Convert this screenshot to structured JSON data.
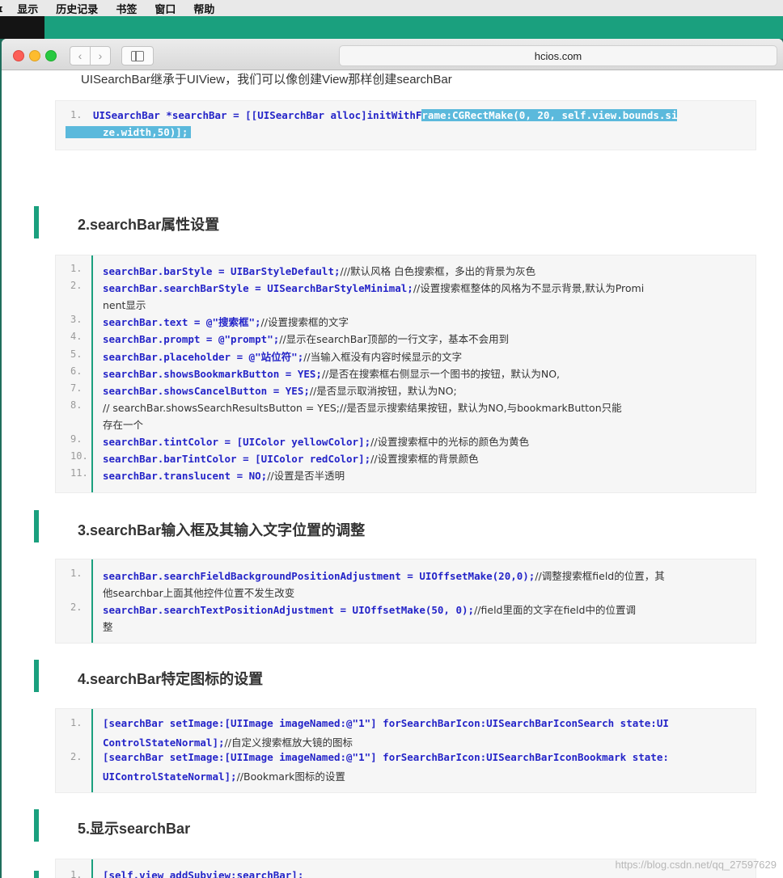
{
  "menubar": {
    "items": [
      "显示",
      "历史记录",
      "书签",
      "窗口",
      "帮助"
    ],
    "first_stub": "ɪ"
  },
  "browser": {
    "url": "hcios.com",
    "back_glyph": "‹",
    "forward_glyph": "›"
  },
  "intro_text": "UISearchBar继承于UIView，我们可以像创建View那样创建searchBar",
  "block1": {
    "line1_num": "1.",
    "line1_a": " UISearchBar *searchBar = [[UISearchBar alloc]initWithF",
    "line1_b": "rame:CGRectMake(0, 20, self.view.bounds.si",
    "line1_c": "ze.width,50)];"
  },
  "headings": {
    "h2": "2.searchBar属性设置",
    "h3": "3.searchBar输入框及其输入文字位置的调整",
    "h4": "4.searchBar特定图标的设置",
    "h5": "5.显示searchBar"
  },
  "block2": {
    "lines": [
      {
        "n": "1.",
        "code": "  searchBar.barStyle = UIBarStyleDefault;",
        "cmt": "///默认风格 白色搜索框，多出的背景为灰色"
      },
      {
        "n": "2.",
        "code": "   searchBar.searchBarStyle = UISearchBarStyleMinimal;",
        "cmt": "//设置搜索框整体的风格为不显示背景,默认为Promi"
      },
      {
        "n": "",
        "code": "",
        "cmt": "nent显示"
      },
      {
        "n": "3.",
        "code": "   searchBar.text = @\"搜索框\";",
        "cmt": "//设置搜索框的文字"
      },
      {
        "n": "4.",
        "code": "   searchBar.prompt = @\"prompt\";",
        "cmt": "//显示在searchBar顶部的一行文字，基本不会用到"
      },
      {
        "n": "5.",
        "code": "   searchBar.placeholder = @\"站位符\";",
        "cmt": "//当输入框没有内容时候显示的文字"
      },
      {
        "n": "6.",
        "code": "   searchBar.showsBookmarkButton = YES;",
        "cmt": "//是否在搜索框右侧显示一个图书的按钮，默认为NO,"
      },
      {
        "n": "7.",
        "code": "   searchBar.showsCancelButton = YES;",
        "cmt": "//是否显示取消按钮，默认为NO;"
      },
      {
        "n": "8.",
        "code": "",
        "cmt": " // searchBar.showsSearchResultsButton = YES;//是否显示搜索结果按钮，默认为NO,与bookmarkButton只能"
      },
      {
        "n": "",
        "code": "",
        "cmt": "存在一个"
      },
      {
        "n": "9.",
        "code": "   searchBar.tintColor = [UIColor yellowColor];",
        "cmt": "//设置搜索框中的光标的颜色为黄色"
      },
      {
        "n": "10.",
        "code": "   searchBar.barTintColor = [UIColor redColor];",
        "cmt": "//设置搜索框的背景颜色"
      },
      {
        "n": "11.",
        "code": "   searchBar.translucent = NO;",
        "cmt": "//设置是否半透明"
      }
    ]
  },
  "block3": {
    "lines": [
      {
        "n": "1.",
        "code": "searchBar.searchFieldBackgroundPositionAdjustment = UIOffsetMake(20,0);",
        "cmt": "//调整搜索框field的位置，其"
      },
      {
        "n": "",
        "code": "",
        "cmt": "他searchbar上面其他控件位置不发生改变"
      },
      {
        "n": "2.",
        "code": "    searchBar.searchTextPositionAdjustment = UIOffsetMake(50, 0);",
        "cmt": "//field里面的文字在field中的位置调"
      },
      {
        "n": "",
        "code": "",
        "cmt": "整"
      }
    ]
  },
  "block4": {
    "lines": [
      {
        "n": "1.",
        "code": "    [searchBar setImage:[UIImage imageNamed:@\"1\"] forSearchBarIcon:UISearchBarIconSearch state:UI",
        "cmt": ""
      },
      {
        "n": "",
        "code": "ControlStateNormal];",
        "cmt": "//自定义搜索框放大镜的图标"
      },
      {
        "n": "2.",
        "code": "    [searchBar setImage:[UIImage imageNamed:@\"1\"] forSearchBarIcon:UISearchBarIconBookmark state:",
        "cmt": ""
      },
      {
        "n": "",
        "code": "UIControlStateNormal];",
        "cmt": "//Bookmark图标的设置"
      }
    ]
  },
  "block5": {
    "lines": [
      {
        "n": "1.",
        "code": "[self.view addSubview:searchBar];",
        "cmt": ""
      }
    ]
  },
  "watermark": "https://blog.csdn.net/qq_27597629",
  "colors": {
    "accent": "#1aa07e",
    "code_blue": "#2424c8",
    "selection": "#5bb9dc"
  }
}
